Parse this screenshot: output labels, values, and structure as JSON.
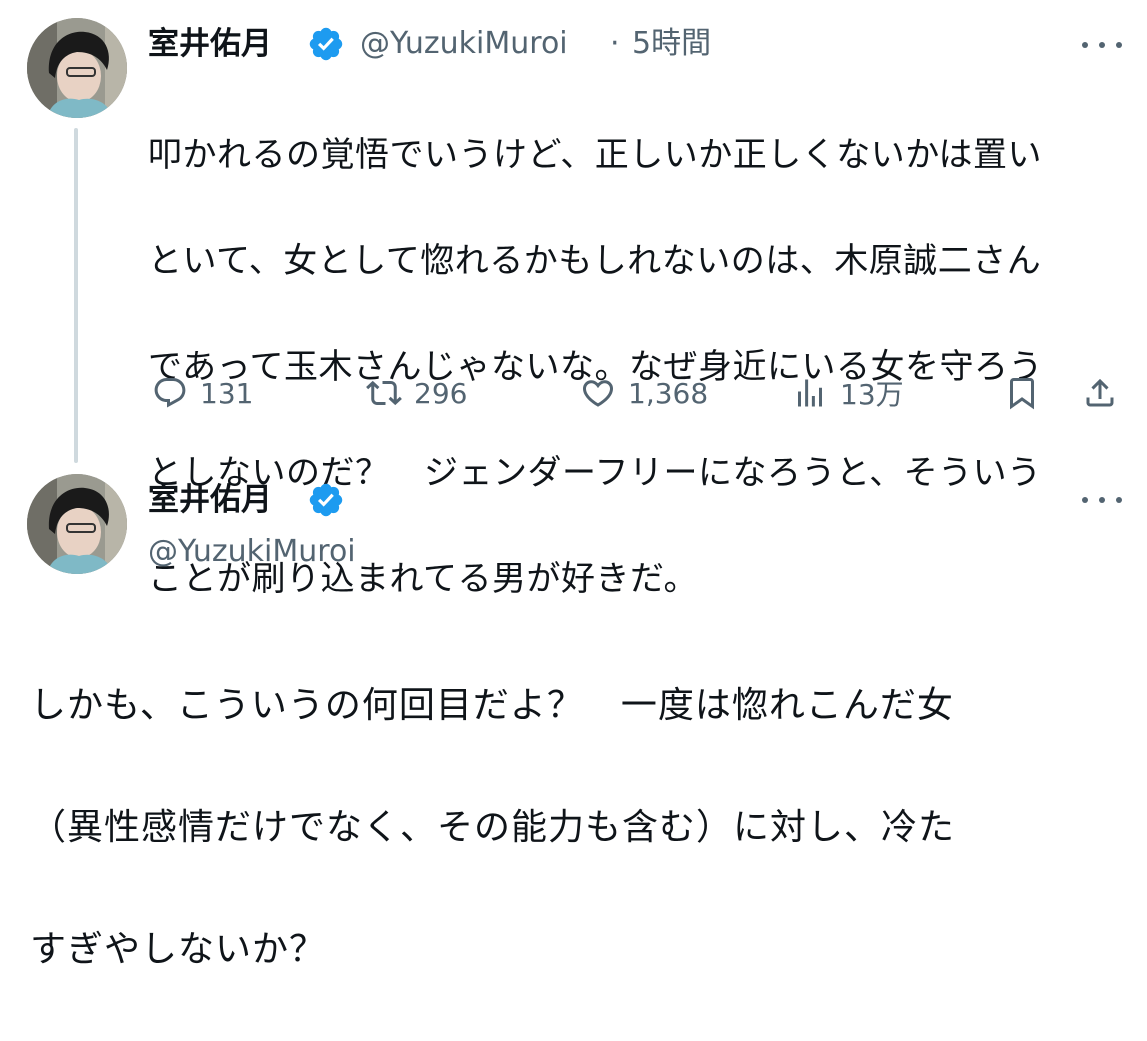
{
  "tweet1": {
    "author_name": "室井佑月",
    "handle": "@YuzukiMuroi",
    "separator": "·",
    "time": "5時間",
    "text_lines": [
      "叩かれるの覚悟でいうけど、正しいか正しくないかは置い",
      "といて、女として惚れるかもしれないのは、木原誠二さん",
      "であって玉木さんじゃないな。なぜ身近にいる女を守ろう",
      "としないのだ？　ジェンダーフリーになろうと、そういう",
      "ことが刷り込まれてる男が好きだ。"
    ],
    "replies": "131",
    "reposts": "296",
    "likes": "1,368",
    "views": "13万"
  },
  "tweet2": {
    "author_name": "室井佑月",
    "handle": "@YuzukiMuroi",
    "text_lines": [
      "しかも、こういうの何回目だよ？　一度は惚れこんだ女",
      "（異性感情だけでなく、その能力も含む）に対し、冷た",
      "すぎやしないか？"
    ]
  },
  "colors": {
    "text": "#0f1419",
    "secondary": "#536471",
    "verified": "#1d9bf0",
    "thread_line": "#cfd9de"
  },
  "icons": [
    "verified-badge-icon",
    "more-icon",
    "reply-icon",
    "repost-icon",
    "like-icon",
    "views-icon",
    "bookmark-icon",
    "share-icon"
  ]
}
